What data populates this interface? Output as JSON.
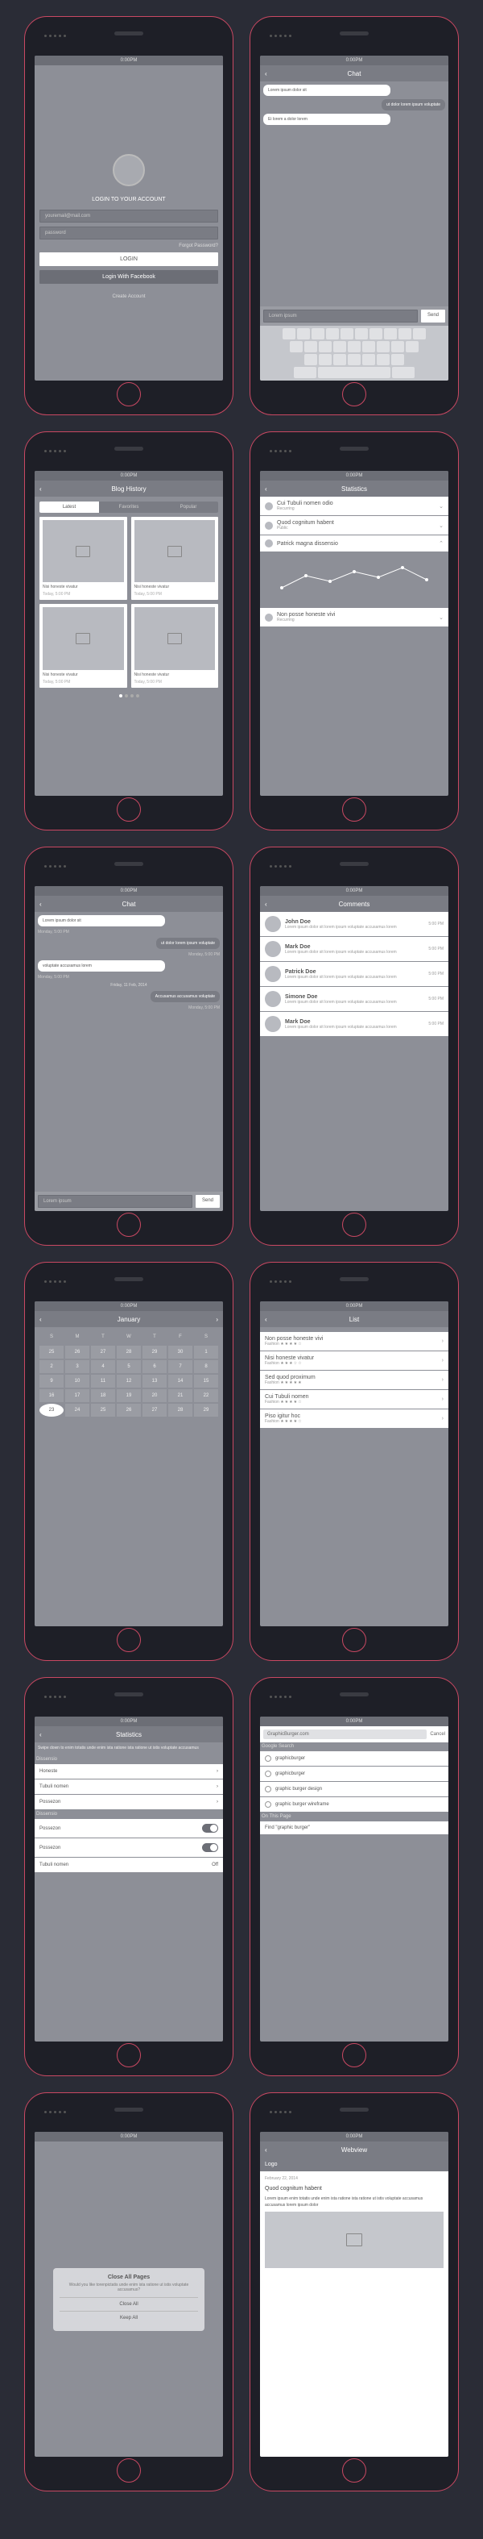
{
  "status_time": "0:00PM",
  "login": {
    "header": "LOGIN TO YOUR ACCOUNT",
    "email": "youremail@mail.com",
    "password": "password",
    "forgot": "Forgot Password?",
    "login_btn": "LOGIN",
    "fb_btn": "Login With Facebook",
    "create": "Create Account"
  },
  "blog": {
    "title": "Blog History",
    "tabs": [
      "Latest",
      "Favorites",
      "Popular"
    ],
    "caption": "Nisi honeste vivatur",
    "date": "Today, 5:00 PM"
  },
  "stats": {
    "title": "Statistics",
    "items": [
      {
        "t": "Cui Tubuli nomen odio",
        "s": "Recurring"
      },
      {
        "t": "Quod cognitum habent",
        "s": "Public"
      },
      {
        "t": "Patrick magna dissensio",
        "s": ""
      },
      {
        "t": "Non posse honeste vivi",
        "s": "Recurring"
      }
    ]
  },
  "chart_data": {
    "type": "line",
    "x": [
      1,
      2,
      3,
      4,
      5,
      6,
      7
    ],
    "values": [
      20,
      35,
      28,
      40,
      33,
      45,
      30
    ]
  },
  "chat": {
    "title": "Chat",
    "placeholder": "Lorem ipsum",
    "send": "Send",
    "msgs": [
      "Lorem ipsum dolor sit",
      "ut dolor lorem ipsum voluptate",
      "Ei lorem a dolor lorem",
      "voluptate accusamus lorem",
      "Accusamus accusamus voluptate"
    ],
    "divider": "Friday, 11 Feb, 2014",
    "ts": "Monday, 5:00 PM"
  },
  "comments": {
    "title": "Comments",
    "list": [
      {
        "n": "John Doe",
        "ts": "5:00 PM"
      },
      {
        "n": "Mark Doe",
        "ts": "5:00 PM"
      },
      {
        "n": "Patrick Doe",
        "ts": "5:00 PM"
      },
      {
        "n": "Simone Doe",
        "ts": "5:00 PM"
      },
      {
        "n": "Mark Doe",
        "ts": "5:00 PM"
      }
    ],
    "body": "Lorem ipsum dolor sit lorem ipsum voluptate accusamus lorem"
  },
  "cal": {
    "month": "January",
    "days": [
      "S",
      "M",
      "T",
      "W",
      "T",
      "F",
      "S"
    ],
    "dates": [
      25,
      26,
      27,
      28,
      29,
      30,
      1,
      2,
      3,
      4,
      5,
      6,
      7,
      8,
      9,
      10,
      11,
      12,
      13,
      14,
      15,
      16,
      17,
      18,
      19,
      20,
      21,
      22,
      23,
      24,
      25,
      26,
      27,
      28,
      29
    ]
  },
  "list": {
    "title": "List",
    "items": [
      "Non posse honeste vivi",
      "Nisi honeste vivatur",
      "Sed quod proximum",
      "Cui Tubuli nomen",
      "Piso igitur hoc"
    ],
    "cat": "Fashion"
  },
  "settings": {
    "title": "Statistics",
    "desc": "Swipe down to enim totatis unde enim ista ratione ista ratione ut istis voluptate accusamus",
    "sec": "Dissensio",
    "items": [
      "Honeste",
      "Tubuli nomen",
      "Possezon"
    ],
    "sec2": "Dissensio",
    "items2": [
      {
        "t": "Possezon",
        "v": "on"
      },
      {
        "t": "Possezon",
        "v": "on"
      },
      {
        "t": "Tubuli nomen",
        "v": "Off"
      }
    ]
  },
  "search": {
    "query": "GraphicBurger.com",
    "cancel": "Cancel",
    "sec1": "Google Search",
    "results": [
      "graphicburger",
      "graphicburger",
      "graphic burger design",
      "graphic burger wireframe"
    ],
    "sec2": "On This Page",
    "find": "Find \"graphic burger\""
  },
  "dialog": {
    "title": "Close All Pages",
    "body": "Would you like torenpictatis unde enim ista ratione ut istis voluptate accusamus?",
    "b1": "Close All",
    "b2": "Keep All"
  },
  "web": {
    "title": "Webview",
    "logo": "Logo",
    "date": "February 22, 2014",
    "heading": "Quod cognitum habent",
    "body": "Lorem ipsum enim totatis unde enim ista ratione ista ratione ut istis voluptate accusamus accusamus lorem ipsum dolor"
  }
}
